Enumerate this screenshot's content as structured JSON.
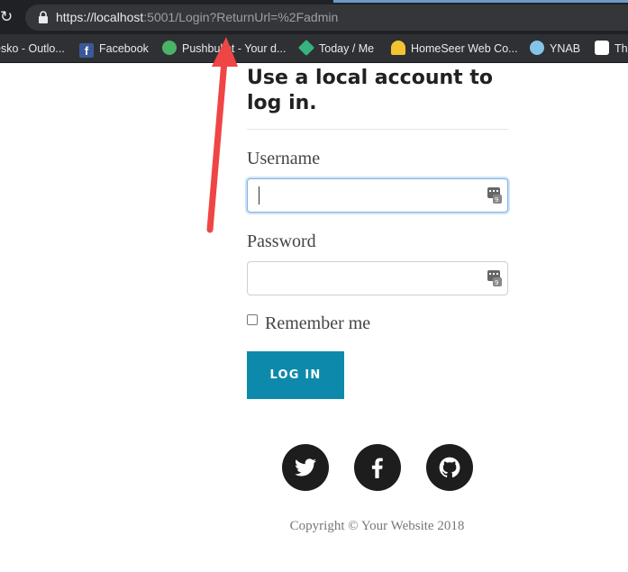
{
  "browser": {
    "url_scheme": "https://",
    "url_host": "localhost",
    "url_rest": ":5001/Login?ReturnUrl=%2Fadmin",
    "bookmarks": [
      {
        "label": "esko - Outlo...",
        "icon": "outlook-icon",
        "color": "#0a64a4"
      },
      {
        "label": "Facebook",
        "icon": "facebook-icon",
        "color": "#3b5998"
      },
      {
        "label": "Pushbullet - Your d...",
        "icon": "pushbullet-icon",
        "color": "#4ab367"
      },
      {
        "label": "Today / Me",
        "icon": "today-icon",
        "color": "#36b37e"
      },
      {
        "label": "HomeSeer Web Co...",
        "icon": "homeseer-icon",
        "color": "#f4c430"
      },
      {
        "label": "YNAB",
        "icon": "ynab-icon",
        "color": "#85c3e9"
      },
      {
        "label": "Th",
        "icon": "cow-icon",
        "color": "#ffffff"
      }
    ]
  },
  "form": {
    "heading": "Use a local account to log in.",
    "username_label": "Username",
    "username_value": "",
    "password_label": "Password",
    "password_value": "",
    "remember_label": "Remember me",
    "remember_checked": false,
    "login_label": "LOG IN"
  },
  "social": [
    {
      "name": "twitter-icon"
    },
    {
      "name": "facebook-icon"
    },
    {
      "name": "github-icon"
    }
  ],
  "footer": {
    "copyright": "Copyright © Your Website 2018"
  },
  "colors": {
    "button": "#0d8aab",
    "annotation_arrow": "#f04545"
  }
}
